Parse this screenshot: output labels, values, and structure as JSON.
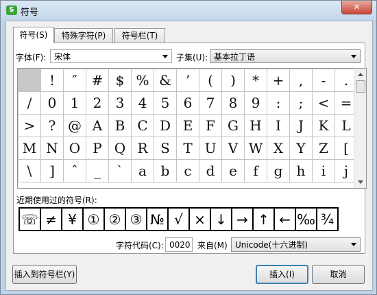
{
  "window": {
    "title": "符号",
    "app_icon_letter": "S",
    "close_glyph": "✕"
  },
  "tabs": [
    {
      "label": "符号(S)",
      "active": true
    },
    {
      "label": "特殊字符(P)",
      "active": false
    },
    {
      "label": "符号栏(T)",
      "active": false
    }
  ],
  "font": {
    "label": "字体(F):",
    "value": "宋体"
  },
  "subset": {
    "label": "子集(U):",
    "value": "基本拉丁语"
  },
  "symbol_grid": [
    [
      "",
      "!",
      "″",
      "#",
      "$",
      "%",
      "&",
      "’",
      "(",
      ")",
      "*",
      "+",
      ",",
      "-",
      "."
    ],
    [
      "/",
      "0",
      "1",
      "2",
      "3",
      "4",
      "5",
      "6",
      "7",
      "8",
      "9",
      ":",
      ";",
      "<",
      "="
    ],
    [
      ">",
      "?",
      "@",
      "A",
      "B",
      "C",
      "D",
      "E",
      "F",
      "G",
      "H",
      "I",
      "J",
      "K",
      "L"
    ],
    [
      "M",
      "N",
      "O",
      "P",
      "Q",
      "R",
      "S",
      "T",
      "U",
      "V",
      "W",
      "X",
      "Y",
      "Z",
      "["
    ],
    [
      "\\",
      "]",
      "ˆ",
      "_",
      "ˋ",
      "a",
      "b",
      "c",
      "d",
      "e",
      "f",
      "g",
      "h",
      "i",
      "j"
    ]
  ],
  "recent": {
    "label": "近期使用过的符号(R):",
    "symbols": [
      "☏",
      "≠",
      "¥",
      "①",
      "②",
      "③",
      "№",
      "√",
      "×",
      "↓",
      "→",
      "↑",
      "←",
      "‰",
      "¾"
    ]
  },
  "char_code": {
    "label": "字符代码(C):",
    "value": "0020"
  },
  "from": {
    "label": "来自(M)",
    "value": "Unicode(十六进制)"
  },
  "buttons": {
    "insert_to_bar": "插入到符号栏(Y)",
    "insert": "插入(I)",
    "cancel": "取消"
  }
}
